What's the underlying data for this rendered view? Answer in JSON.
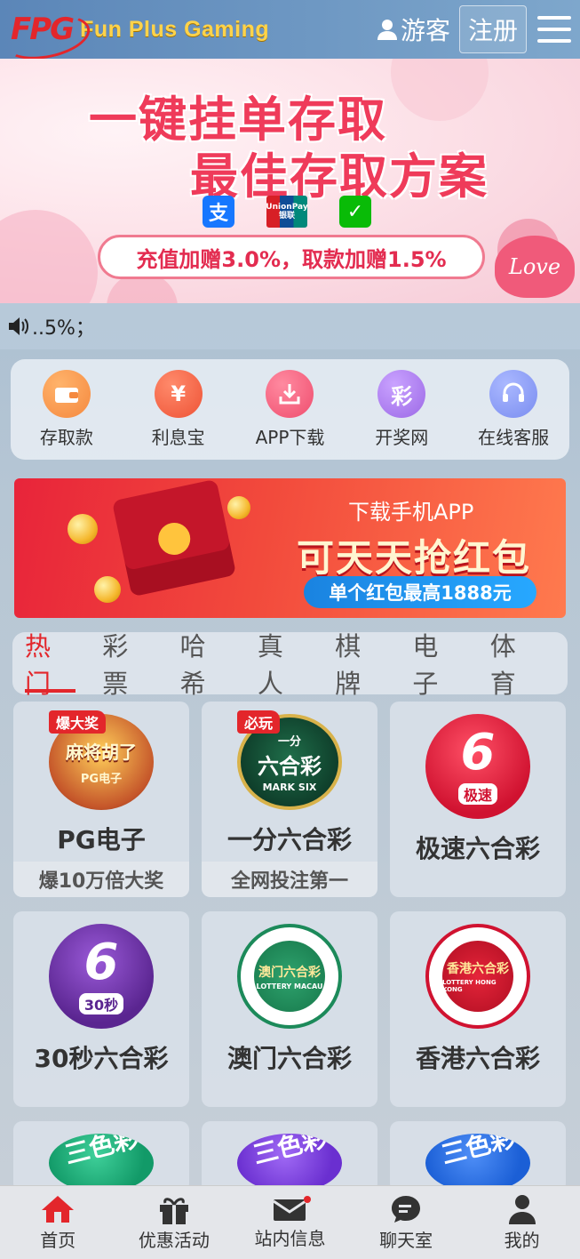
{
  "header": {
    "logo_mark": "FPG",
    "logo_text": "Fun Plus Gaming",
    "guest_label": "游客",
    "register_label": "注册"
  },
  "banner": {
    "line1": "一键挂单存取",
    "line2": "最佳存取方案",
    "pill_text": "充值加赠3.0%，取款加赠1.5%",
    "love_text": "Love",
    "union_text": "UnionPay 银联"
  },
  "notice": {
    "text": "..5%；"
  },
  "quick_menu": [
    {
      "label": "存取款",
      "icon": "wallet-icon",
      "color": "#f5893f"
    },
    {
      "label": "利息宝",
      "icon": "yen-icon",
      "color": "#ee5336"
    },
    {
      "label": "APP下载",
      "icon": "download-icon",
      "color": "#ef4d6e"
    },
    {
      "label": "开奖网",
      "icon": "lottery-icon",
      "color": "#9c69e6"
    },
    {
      "label": "在线客服",
      "icon": "headset-icon",
      "color": "#7a8df0"
    }
  ],
  "promo": {
    "line1": "下载手机APP",
    "line2": "可天天抢红包",
    "pill": "单个红包最高1888元"
  },
  "tabs": [
    "热门",
    "彩票",
    "哈希",
    "真人",
    "棋牌",
    "电子",
    "体育"
  ],
  "games": [
    {
      "title": "PG电子",
      "subtitle": "爆10万倍大奖",
      "tag": "爆大奖",
      "icon_text": "麻将胡了",
      "icon_sub": "PG电子"
    },
    {
      "title": "一分六合彩",
      "subtitle": "全网投注第一",
      "tag": "必玩",
      "icon_text": "六合彩",
      "icon_sub": "MARK SIX",
      "icon_top": "一分"
    },
    {
      "title": "极速六合彩",
      "subtitle": "",
      "icon_text": "6",
      "icon_sub": "极速"
    },
    {
      "title": "30秒六合彩",
      "subtitle": "",
      "icon_text": "6",
      "icon_sub": "30秒"
    },
    {
      "title": "澳门六合彩",
      "subtitle": "",
      "icon_text": "澳门六合彩",
      "icon_sub": "LOTTERY MACAU"
    },
    {
      "title": "香港六合彩",
      "subtitle": "",
      "icon_text": "香港六合彩",
      "icon_sub": "LOTTERY HONG KONG"
    },
    {
      "title": "",
      "subtitle": "",
      "icon_text": "三色彩"
    },
    {
      "title": "",
      "subtitle": "",
      "icon_text": "三色彩"
    },
    {
      "title": "",
      "subtitle": "",
      "icon_text": "三色彩"
    }
  ],
  "bottom_nav": [
    {
      "label": "首页",
      "icon": "home-icon",
      "active": true
    },
    {
      "label": "优惠活动",
      "icon": "gift-icon"
    },
    {
      "label": "站内信息",
      "icon": "mail-icon",
      "badge": true
    },
    {
      "label": "聊天室",
      "icon": "chat-icon"
    },
    {
      "label": "我的",
      "icon": "user-icon"
    }
  ],
  "colors": {
    "accent": "#e3262b",
    "header": "#5b86b8"
  }
}
